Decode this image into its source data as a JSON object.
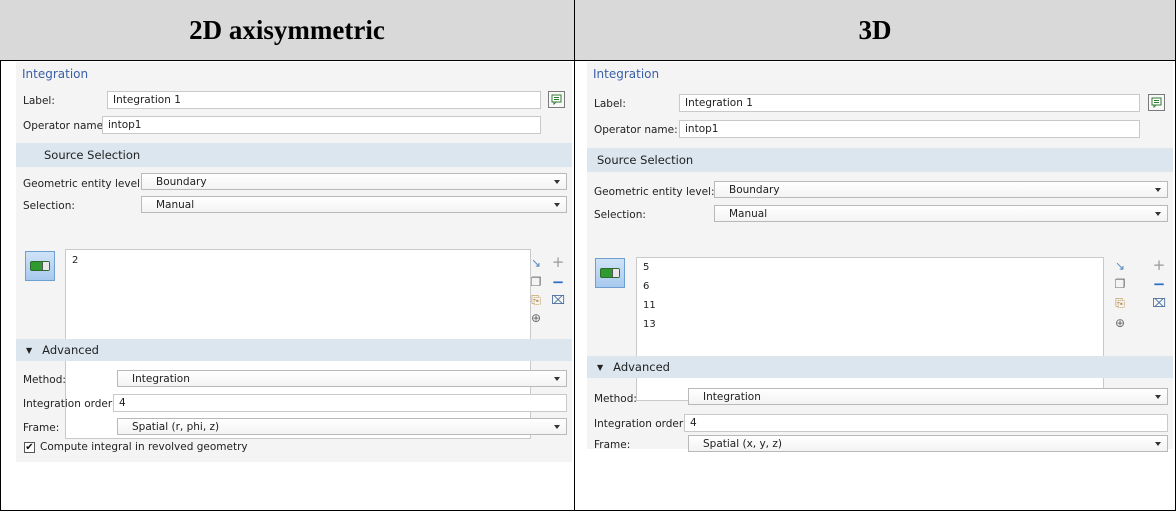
{
  "headers": {
    "left": "2D axisymmetric",
    "right": "3D"
  },
  "left": {
    "title": "Integration",
    "label_caption": "Label:",
    "label_value": "Integration 1",
    "operator_caption": "Operator name:",
    "operator_value": "intop1",
    "source_section": "Source Selection",
    "entity_caption": "Geometric entity level:",
    "entity_value": "Boundary",
    "selection_caption": "Selection:",
    "selection_value": "Manual",
    "items": [
      "2"
    ],
    "advanced_section": "Advanced",
    "method_caption": "Method:",
    "method_value": "Integration",
    "order_caption": "Integration order:",
    "order_value": "4",
    "frame_caption": "Frame:",
    "frame_value": "Spatial  (r, phi, z)",
    "revolved_label": "Compute integral in revolved geometry",
    "revolved_checked": true
  },
  "right": {
    "title": "Integration",
    "label_caption": "Label:",
    "label_value": "Integration 1",
    "operator_caption": "Operator name:",
    "operator_value": "intop1",
    "source_section": "Source Selection",
    "entity_caption": "Geometric entity level:",
    "entity_value": "Boundary",
    "selection_caption": "Selection:",
    "selection_value": "Manual",
    "items": [
      "5",
      "6",
      "11",
      "13"
    ],
    "advanced_section": "Advanced",
    "method_caption": "Method:",
    "method_value": "Integration",
    "order_caption": "Integration order:",
    "order_value": "4",
    "frame_caption": "Frame:",
    "frame_value": "Spatial  (x, y, z)"
  },
  "icons": {
    "note": "note-icon",
    "toggle": "active-toggle-icon",
    "paste_selection": "paste-selection-icon",
    "copy": "copy-icon",
    "clipboard": "clipboard-icon",
    "zoom_selected": "zoom-selected-icon",
    "add": "add-icon",
    "remove": "remove-icon",
    "clear": "clear-selection-icon",
    "collapse": "collapse-triangle-icon"
  },
  "colors": {
    "title_blue": "#3a5fa8",
    "section_bg": "#dbe6ef",
    "panel_bg": "#f4f4f4",
    "header_bg": "#d9d9d9",
    "add_gray": "#9a9a9a",
    "remove_blue": "#2d6fc4"
  }
}
